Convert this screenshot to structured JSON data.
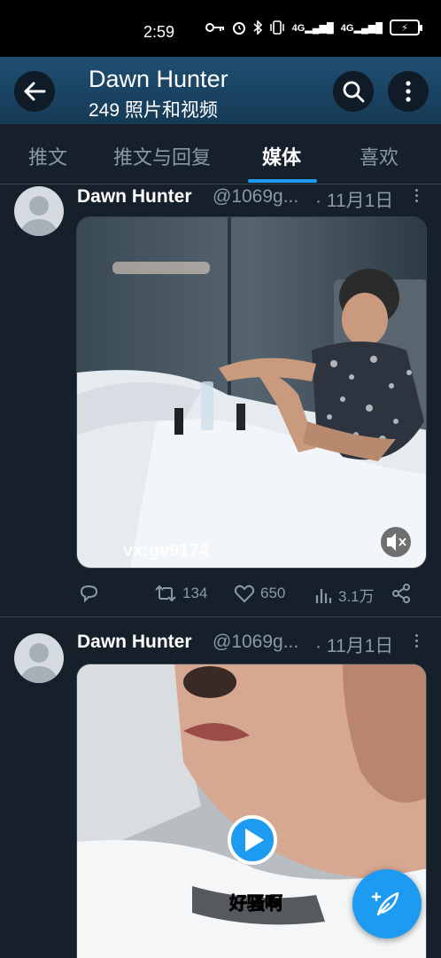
{
  "status_bar": {
    "time": "2:59",
    "icons": [
      "key-icon",
      "alarm-icon",
      "bluetooth-icon",
      "vibrate-icon",
      "signal-4g-icon",
      "signal-4g-icon",
      "battery-charging-icon"
    ],
    "sig1": "4G",
    "sig2": "4G"
  },
  "header": {
    "title": "Dawn Hunter",
    "subtitle": "249 照片和视频"
  },
  "tabs": [
    {
      "label": "推文"
    },
    {
      "label": "推文与回复"
    },
    {
      "label": "媒体"
    },
    {
      "label": "喜欢"
    }
  ],
  "posts": [
    {
      "name": "Dawn Hunter",
      "handle": "@1069g...",
      "date": "· 11月1日",
      "watermark": "vx:gv9174",
      "retweets": "134",
      "likes": "650",
      "views": "3.1万"
    },
    {
      "name": "Dawn Hunter",
      "handle": "@1069g...",
      "date": "· 11月1日",
      "caption": "好骚啊"
    }
  ],
  "colors": {
    "background": "#15202b",
    "accent": "#1d9bf0",
    "muted_text": "#8b98a5",
    "header_top": "#1f4e72"
  }
}
